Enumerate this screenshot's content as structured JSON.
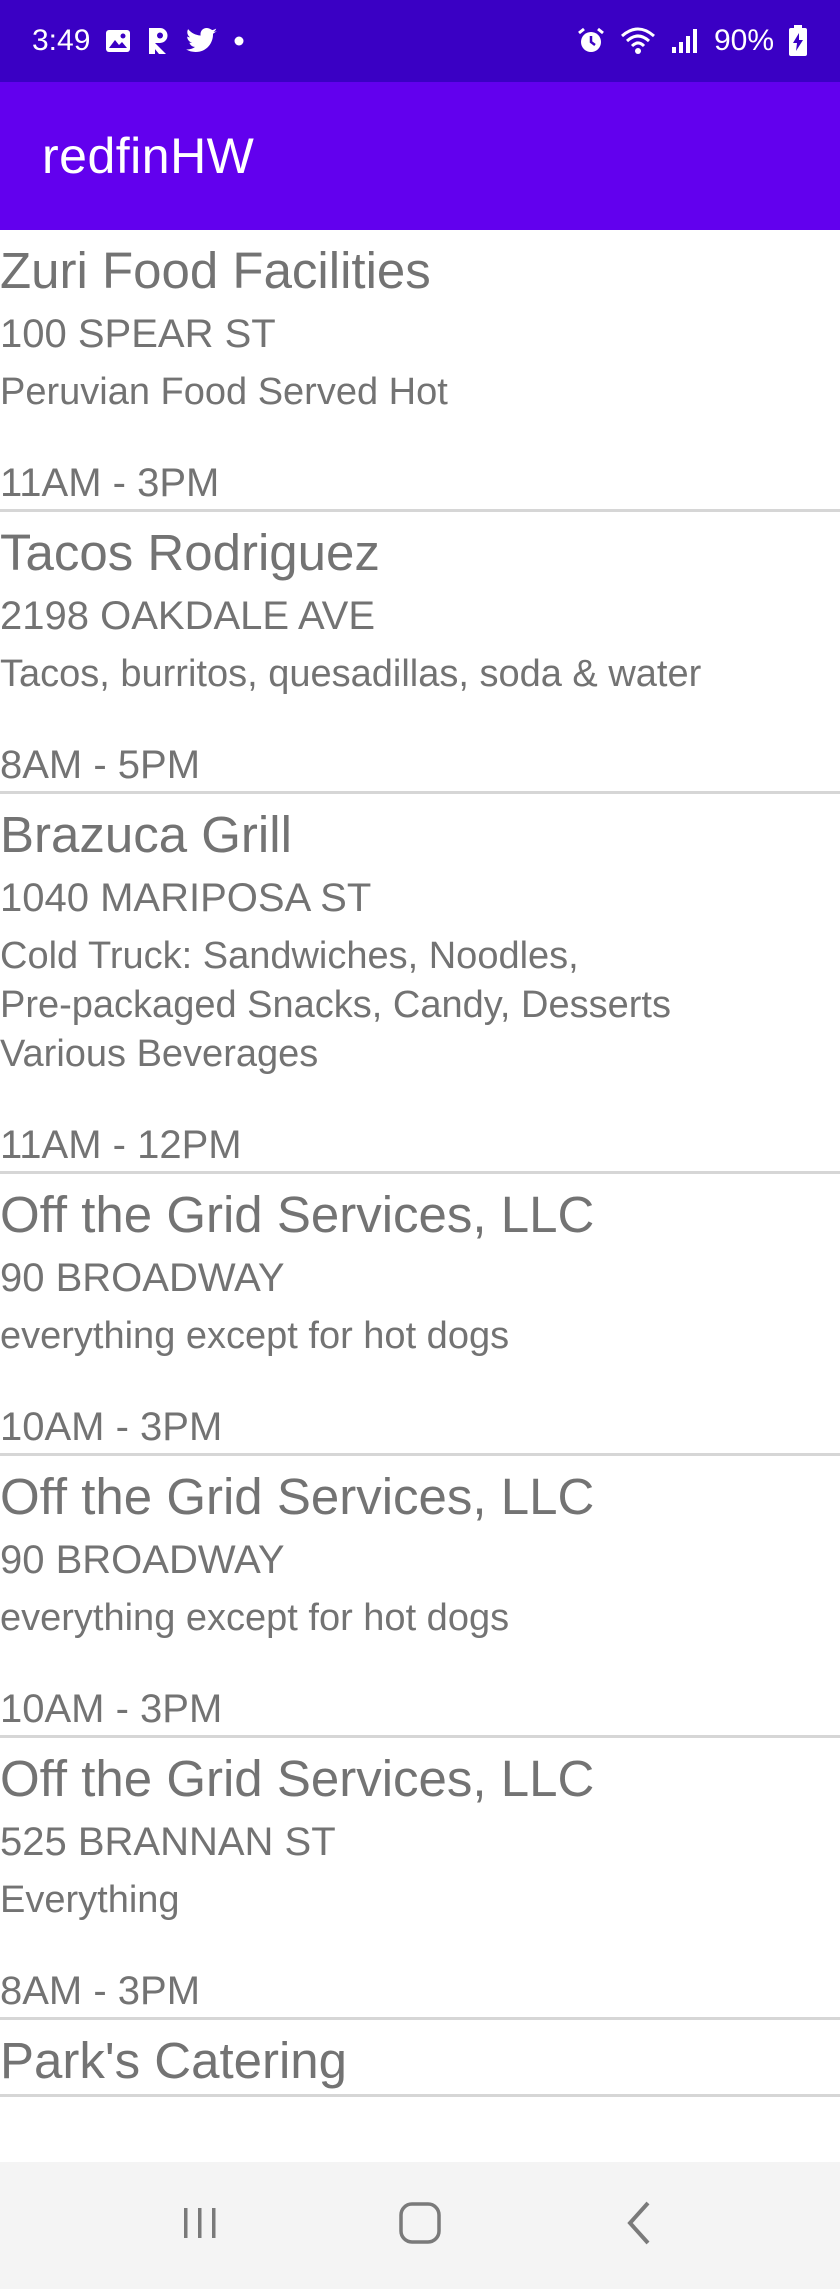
{
  "status_bar": {
    "time": "3:49",
    "battery_pct": "90%",
    "icons_left": [
      "image-icon",
      "r-icon",
      "twitter-icon",
      "dot-icon"
    ],
    "icons_right": [
      "alarm-icon",
      "wifi-icon",
      "signal-icon",
      "battery-charging-icon"
    ]
  },
  "app_bar": {
    "title": "redfinHW"
  },
  "items": [
    {
      "name": "Zuri Food Facilities",
      "address": "100 SPEAR ST",
      "description": "Peruvian Food Served Hot",
      "hours": "11AM - 3PM"
    },
    {
      "name": "Tacos Rodriguez",
      "address": "2198 OAKDALE AVE",
      "description": "Tacos, burritos, quesadillas, soda & water",
      "hours": "8AM - 5PM"
    },
    {
      "name": "Brazuca Grill",
      "address": "1040 MARIPOSA ST",
      "description": "Cold Truck: Sandwiches, Noodles,\nPre-packaged Snacks, Candy, Desserts\nVarious Beverages",
      "hours": "11AM - 12PM"
    },
    {
      "name": "Off the Grid Services, LLC",
      "address": "90 BROADWAY",
      "description": "everything except for hot dogs",
      "hours": "10AM - 3PM"
    },
    {
      "name": "Off the Grid Services, LLC",
      "address": "90 BROADWAY",
      "description": "everything except for hot dogs",
      "hours": "10AM - 3PM"
    },
    {
      "name": "Off the Grid Services, LLC",
      "address": "525 BRANNAN ST",
      "description": "Everything",
      "hours": "8AM - 3PM"
    },
    {
      "name": "Park's Catering",
      "address": "",
      "description": "",
      "hours": ""
    }
  ],
  "nav_bar": {
    "buttons": [
      "recents-icon",
      "home-icon",
      "back-icon"
    ]
  },
  "colors": {
    "status_bar": "#3a00c4",
    "app_bar": "#6200ee",
    "text": "#737373",
    "divider": "#d6d6d6",
    "nav_bg": "#f4f4f4"
  }
}
